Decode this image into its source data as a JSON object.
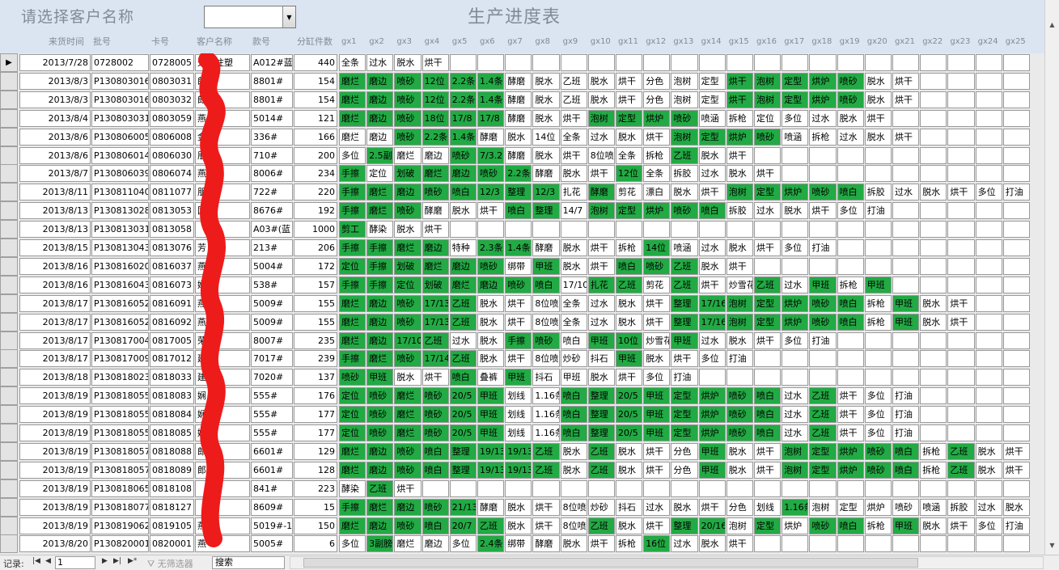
{
  "prompt": "请选择客户名称",
  "title": "生产进度表",
  "customer_select": {
    "value": ""
  },
  "columns": [
    "来货时间",
    "批号",
    "卡号",
    "客户名称",
    "款号",
    "分缸件数",
    "gx1",
    "gx2",
    "gx3",
    "gx4",
    "gx5",
    "gx6",
    "gx7",
    "gx8",
    "gx9",
    "gx10",
    "gx11",
    "gx12",
    "gx13",
    "gx14",
    "gx15",
    "gx16",
    "gx17",
    "gx18",
    "gx19",
    "gx20",
    "gx21",
    "gx22",
    "gx23",
    "gx24",
    "gx25"
  ],
  "rows": [
    {
      "date": "2013/7/28",
      "batch": "0728002",
      "card": "0728005",
      "customer": "天宏注塑",
      "style": "A012#蓝",
      "qty": "440",
      "steps": [
        "全条",
        "过水",
        "脱水",
        "烘干"
      ],
      "green": []
    },
    {
      "date": "2013/8/3",
      "batch": "P130803016",
      "card": "0803031",
      "customer": "郎",
      "style": "8801#",
      "qty": "154",
      "steps": [
        "磨烂",
        "磨边",
        "喷砂",
        "12位",
        "2.2条",
        "1.4条",
        "酵磨",
        "脱水",
        "乙班",
        "脱水",
        "烘干",
        "分色",
        "泡树",
        "定型",
        "烘干",
        "泡树",
        "定型",
        "烘炉",
        "喷砂",
        "脱水",
        "烘干"
      ],
      "green": [
        0,
        1,
        2,
        3,
        4,
        5,
        14,
        15,
        16,
        17,
        18
      ]
    },
    {
      "date": "2013/8/3",
      "batch": "P130803016",
      "card": "0803032",
      "customer": "郎",
      "style": "8801#",
      "qty": "154",
      "steps": [
        "磨烂",
        "磨边",
        "喷砂",
        "12位",
        "2.2条",
        "1.4条",
        "酵磨",
        "脱水",
        "乙班",
        "脱水",
        "烘干",
        "分色",
        "泡树",
        "定型",
        "烘干",
        "泡树",
        "定型",
        "烘炉",
        "喷砂",
        "脱水",
        "烘干"
      ],
      "green": [
        0,
        1,
        2,
        3,
        4,
        5,
        14,
        15,
        16,
        17,
        18
      ]
    },
    {
      "date": "2013/8/4",
      "batch": "P130803031",
      "card": "0803059",
      "customer": "燕",
      "style": "5014#",
      "qty": "121",
      "steps": [
        "磨烂",
        "磨边",
        "喷砂",
        "18位",
        "17/8",
        "17/8",
        "酵磨",
        "脱水",
        "烘干",
        "泡树",
        "定型",
        "烘炉",
        "喷砂",
        "喷涵",
        "拆枪",
        "定位",
        "多位",
        "过水",
        "脱水",
        "烘干"
      ],
      "green": [
        0,
        1,
        2,
        3,
        4,
        5,
        9,
        10,
        11,
        12
      ]
    },
    {
      "date": "2013/8/6",
      "batch": "P130806005",
      "card": "0806008",
      "customer": "金",
      "style": "336#",
      "qty": "166",
      "steps": [
        "磨烂",
        "磨边",
        "喷砂",
        "2.2条",
        "1.4条",
        "酵磨",
        "脱水",
        "14位",
        "全条",
        "过水",
        "脱水",
        "烘干",
        "泡树",
        "定型",
        "烘炉",
        "喷砂",
        "喷涵",
        "拆枪",
        "过水",
        "脱水",
        "烘干"
      ],
      "green": [
        2,
        3,
        4,
        12,
        13,
        14,
        15
      ]
    },
    {
      "date": "2013/8/6",
      "batch": "P130806014",
      "card": "0806030",
      "customer": "朋",
      "style": "710#",
      "qty": "200",
      "steps": [
        "多位",
        "2.5副",
        "磨烂",
        "磨边",
        "喷砂",
        "7/3.2",
        "酵磨",
        "脱水",
        "烘干",
        "8位喷",
        "全条",
        "拆枪",
        "乙班",
        "脱水",
        "烘干"
      ],
      "green": [
        1,
        4,
        5,
        12
      ]
    },
    {
      "date": "2013/8/7",
      "batch": "P130806039",
      "card": "0806074",
      "customer": "燕",
      "style": "8006#",
      "qty": "234",
      "steps": [
        "手擦",
        "定位",
        "划破",
        "磨烂",
        "磨边",
        "喷砂",
        "2.2条",
        "酵磨",
        "脱水",
        "烘干",
        "12位",
        "全条",
        "拆胶",
        "过水",
        "脱水",
        "烘干"
      ],
      "green": [
        0,
        2,
        3,
        4,
        5,
        6,
        10
      ]
    },
    {
      "date": "2013/8/11",
      "batch": "P130811040",
      "card": "0811077",
      "customer": "朋",
      "style": "722#",
      "qty": "220",
      "steps": [
        "手擦",
        "磨烂",
        "磨边",
        "喷砂",
        "喷白",
        "12/3",
        "整理",
        "12/3",
        "扎花",
        "酵磨",
        "剪花",
        "漂白",
        "脱水",
        "烘干",
        "泡树",
        "定型",
        "烘炉",
        "喷砂",
        "喷白",
        "拆胶",
        "过水",
        "脱水",
        "烘干",
        "多位",
        "打油"
      ],
      "green": [
        0,
        1,
        2,
        3,
        4,
        5,
        6,
        7,
        9,
        14,
        15,
        16,
        17,
        18
      ]
    },
    {
      "date": "2013/8/13",
      "batch": "P130813028",
      "card": "0813053",
      "customer": "国",
      "style": "8676#",
      "qty": "192",
      "steps": [
        "手擦",
        "磨烂",
        "喷砂",
        "酵磨",
        "脱水",
        "烘干",
        "喷白",
        "整理",
        "14/7",
        "泡树",
        "定型",
        "烘炉",
        "喷砂",
        "喷白",
        "拆胶",
        "过水",
        "脱水",
        "烘干",
        "多位",
        "打油"
      ],
      "green": [
        0,
        1,
        2,
        6,
        7,
        9,
        10,
        11,
        12,
        13
      ]
    },
    {
      "date": "2013/8/13",
      "batch": "P130813031",
      "card": "0813058",
      "customer": "",
      "style": "A03#(蓝",
      "qty": "1000",
      "steps": [
        "剪工",
        "酵染",
        "脱水",
        "烘干"
      ],
      "green": [
        0
      ]
    },
    {
      "date": "2013/8/15",
      "batch": "P130813043",
      "card": "0813076",
      "customer": "芳",
      "style": "213#",
      "qty": "206",
      "steps": [
        "手擦",
        "手擦",
        "磨烂",
        "磨边",
        "特种",
        "2.3条",
        "1.4条",
        "酵磨",
        "脱水",
        "烘干",
        "拆枪",
        "14位",
        "喷涵",
        "过水",
        "脱水",
        "烘干",
        "多位",
        "打油"
      ],
      "green": [
        0,
        1,
        2,
        3,
        5,
        6,
        11
      ]
    },
    {
      "date": "2013/8/16",
      "batch": "P130816020",
      "card": "0816037",
      "customer": "燕",
      "style": "5004#",
      "qty": "172",
      "steps": [
        "定位",
        "手擦",
        "划破",
        "磨烂",
        "磨边",
        "喷砂",
        "绑带",
        "甲班",
        "脱水",
        "烘干",
        "喷白",
        "喷砂",
        "乙班",
        "脱水",
        "烘干"
      ],
      "green": [
        0,
        1,
        2,
        3,
        4,
        5,
        7,
        10,
        11,
        12
      ]
    },
    {
      "date": "2013/8/16",
      "batch": "P130816043",
      "card": "0816073",
      "customer": "娴",
      "style": "538#",
      "qty": "157",
      "steps": [
        "手擦",
        "手擦",
        "定位",
        "划破",
        "磨烂",
        "磨边",
        "喷砂",
        "喷白",
        "17/10",
        "扎花",
        "乙班",
        "剪花",
        "乙班",
        "烘干",
        "炒雪花",
        "乙班",
        "过水",
        "甲班",
        "拆枪",
        "甲班"
      ],
      "green": [
        0,
        1,
        2,
        3,
        4,
        5,
        6,
        7,
        9,
        10,
        12,
        15,
        17,
        19
      ]
    },
    {
      "date": "2013/8/17",
      "batch": "P130816052",
      "card": "0816091",
      "customer": "燕",
      "style": "5009#",
      "qty": "155",
      "steps": [
        "磨烂",
        "磨边",
        "喷砂",
        "17/13",
        "乙班",
        "脱水",
        "烘干",
        "8位喷",
        "全条",
        "过水",
        "脱水",
        "烘干",
        "整理",
        "17/16",
        "泡树",
        "定型",
        "烘炉",
        "喷砂",
        "喷白",
        "拆枪",
        "甲班",
        "脱水",
        "烘干"
      ],
      "green": [
        0,
        1,
        2,
        3,
        4,
        12,
        13,
        14,
        15,
        16,
        17,
        18,
        20
      ]
    },
    {
      "date": "2013/8/17",
      "batch": "P130816052",
      "card": "0816092",
      "customer": "燕",
      "style": "5009#",
      "qty": "155",
      "steps": [
        "磨烂",
        "磨边",
        "喷砂",
        "17/13",
        "乙班",
        "脱水",
        "烘干",
        "8位喷",
        "全条",
        "过水",
        "脱水",
        "烘干",
        "整理",
        "17/16",
        "泡树",
        "定型",
        "烘炉",
        "喷砂",
        "喷白",
        "拆枪",
        "甲班",
        "脱水",
        "烘干"
      ],
      "green": [
        0,
        1,
        2,
        3,
        4,
        12,
        13,
        14,
        15,
        16,
        17,
        18,
        20
      ]
    },
    {
      "date": "2013/8/17",
      "batch": "P130817004",
      "card": "0817005",
      "customer": "荣",
      "style": "8007#",
      "qty": "235",
      "steps": [
        "磨烂",
        "磨边",
        "17/10",
        "乙班",
        "过水",
        "脱水",
        "手擦",
        "喷砂",
        "喷白",
        "甲班",
        "10位",
        "炒雪花",
        "甲班",
        "过水",
        "脱水",
        "烘干",
        "多位",
        "打油"
      ],
      "green": [
        0,
        1,
        2,
        3,
        6,
        7,
        9,
        10,
        12
      ]
    },
    {
      "date": "2013/8/17",
      "batch": "P130817009",
      "card": "0817012",
      "customer": "建",
      "style": "7017#",
      "qty": "239",
      "steps": [
        "手擦",
        "磨烂",
        "喷砂",
        "17/14",
        "乙班",
        "脱水",
        "烘干",
        "8位喷",
        "炒砂",
        "抖石",
        "甲班",
        "脱水",
        "烘干",
        "多位",
        "打油"
      ],
      "green": [
        0,
        1,
        2,
        3,
        4,
        10
      ]
    },
    {
      "date": "2013/8/18",
      "batch": "P130818023",
      "card": "0818033",
      "customer": "建",
      "style": "7020#",
      "qty": "137",
      "steps": [
        "喷砂",
        "甲班",
        "脱水",
        "烘干",
        "喷白",
        "叠裤",
        "甲班",
        "抖石",
        "甲班",
        "脱水",
        "烘干",
        "多位",
        "打油"
      ],
      "green": [
        0,
        1,
        4,
        6
      ]
    },
    {
      "date": "2013/8/19",
      "batch": "P130818055",
      "card": "0818083",
      "customer": "娴",
      "style": "555#",
      "qty": "176",
      "steps": [
        "定位",
        "喷砂",
        "磨烂",
        "喷砂",
        "20/5",
        "甲班",
        "划线",
        "1.16条",
        "喷白",
        "整理",
        "20/5",
        "甲班",
        "定型",
        "烘炉",
        "喷砂",
        "喷白",
        "过水",
        "乙班",
        "烘干",
        "多位",
        "打油"
      ],
      "green": [
        0,
        1,
        2,
        3,
        4,
        5,
        8,
        9,
        10,
        11,
        12,
        13,
        14,
        15,
        17
      ]
    },
    {
      "date": "2013/8/19",
      "batch": "P130818055",
      "card": "0818084",
      "customer": "娴",
      "style": "555#",
      "qty": "177",
      "steps": [
        "定位",
        "喷砂",
        "磨烂",
        "喷砂",
        "20/5",
        "甲班",
        "划线",
        "1.16条",
        "喷白",
        "整理",
        "20/5",
        "甲班",
        "定型",
        "烘炉",
        "喷砂",
        "喷白",
        "过水",
        "乙班",
        "烘干",
        "多位",
        "打油"
      ],
      "green": [
        0,
        1,
        2,
        3,
        4,
        5,
        8,
        9,
        10,
        11,
        12,
        13,
        14,
        15,
        17
      ]
    },
    {
      "date": "2013/8/19",
      "batch": "P130818055",
      "card": "0818085",
      "customer": "娴",
      "style": "555#",
      "qty": "177",
      "steps": [
        "定位",
        "喷砂",
        "磨烂",
        "喷砂",
        "20/5",
        "甲班",
        "划线",
        "1.16条",
        "喷白",
        "整理",
        "20/5",
        "甲班",
        "定型",
        "烘炉",
        "喷砂",
        "喷白",
        "过水",
        "乙班",
        "烘干",
        "多位",
        "打油"
      ],
      "green": [
        0,
        1,
        2,
        3,
        4,
        5,
        8,
        9,
        10,
        11,
        12,
        13,
        14,
        15,
        17
      ]
    },
    {
      "date": "2013/8/19",
      "batch": "P130818057",
      "card": "0818088",
      "customer": "郎",
      "style": "6601#",
      "qty": "129",
      "steps": [
        "磨烂",
        "磨边",
        "喷砂",
        "喷白",
        "整理",
        "19/13",
        "19/13",
        "乙班",
        "脱水",
        "乙班",
        "脱水",
        "烘干",
        "分色",
        "甲班",
        "脱水",
        "烘干",
        "泡树",
        "定型",
        "烘炉",
        "喷砂",
        "喷白",
        "拆枪",
        "乙班",
        "脱水",
        "烘干"
      ],
      "green": [
        0,
        1,
        2,
        3,
        4,
        5,
        6,
        7,
        9,
        13,
        16,
        17,
        18,
        19,
        20,
        22
      ]
    },
    {
      "date": "2013/8/19",
      "batch": "P130818057",
      "card": "0818089",
      "customer": "郎",
      "style": "6601#",
      "qty": "128",
      "steps": [
        "磨烂",
        "磨边",
        "喷砂",
        "喷白",
        "整理",
        "19/13",
        "19/13",
        "乙班",
        "脱水",
        "乙班",
        "脱水",
        "烘干",
        "分色",
        "甲班",
        "脱水",
        "烘干",
        "泡树",
        "定型",
        "烘炉",
        "喷砂",
        "喷白",
        "拆枪",
        "乙班",
        "脱水",
        "烘干"
      ],
      "green": [
        0,
        1,
        2,
        3,
        4,
        5,
        6,
        7,
        9,
        13,
        16,
        17,
        18,
        19,
        20,
        22
      ]
    },
    {
      "date": "2013/8/19",
      "batch": "P130818065",
      "card": "0818108",
      "customer": "",
      "style": "841#",
      "qty": "223",
      "steps": [
        "酵染",
        "乙班",
        "烘干"
      ],
      "green": [
        1
      ]
    },
    {
      "date": "2013/8/19",
      "batch": "P130818077",
      "card": "0818127",
      "customer": "",
      "style": "8609#",
      "qty": "15",
      "steps": [
        "手擦",
        "磨烂",
        "磨边",
        "喷砂",
        "21/13",
        "酵磨",
        "脱水",
        "烘干",
        "8位喷",
        "炒砂",
        "抖石",
        "过水",
        "脱水",
        "烘干",
        "分色",
        "划线",
        "1.16条",
        "泡树",
        "定型",
        "烘炉",
        "喷砂",
        "喷涵",
        "拆胶",
        "过水",
        "脱水"
      ],
      "green": [
        0,
        1,
        2,
        3,
        4,
        16
      ]
    },
    {
      "date": "2013/8/19",
      "batch": "P130819062",
      "card": "0819105",
      "customer": "燕",
      "style": "5019#-1",
      "qty": "150",
      "steps": [
        "磨烂",
        "磨边",
        "喷砂",
        "喷白",
        "20/7",
        "乙班",
        "脱水",
        "烘干",
        "8位喷",
        "乙班",
        "脱水",
        "烘干",
        "整理",
        "20/16",
        "泡树",
        "定型",
        "烘炉",
        "喷砂",
        "喷白",
        "拆枪",
        "甲班",
        "脱水",
        "烘干",
        "多位",
        "打油"
      ],
      "green": [
        0,
        1,
        2,
        3,
        4,
        5,
        9,
        12,
        13,
        15,
        17,
        18,
        20
      ]
    },
    {
      "date": "2013/8/20",
      "batch": "P130820001",
      "card": "0820001",
      "customer": "燕",
      "style": "5005#",
      "qty": "6",
      "steps": [
        "多位",
        "3副膀",
        "磨烂",
        "磨边",
        "多位",
        "2.4条",
        "绑带",
        "酵磨",
        "脱水",
        "烘干",
        "拆枪",
        "16位",
        "过水",
        "脱水",
        "烘干"
      ],
      "green": [
        1,
        5,
        11
      ]
    }
  ],
  "status": {
    "record_label": "记录:",
    "record_value": "1",
    "filter_label": "无筛选器",
    "search_label": "搜索"
  }
}
